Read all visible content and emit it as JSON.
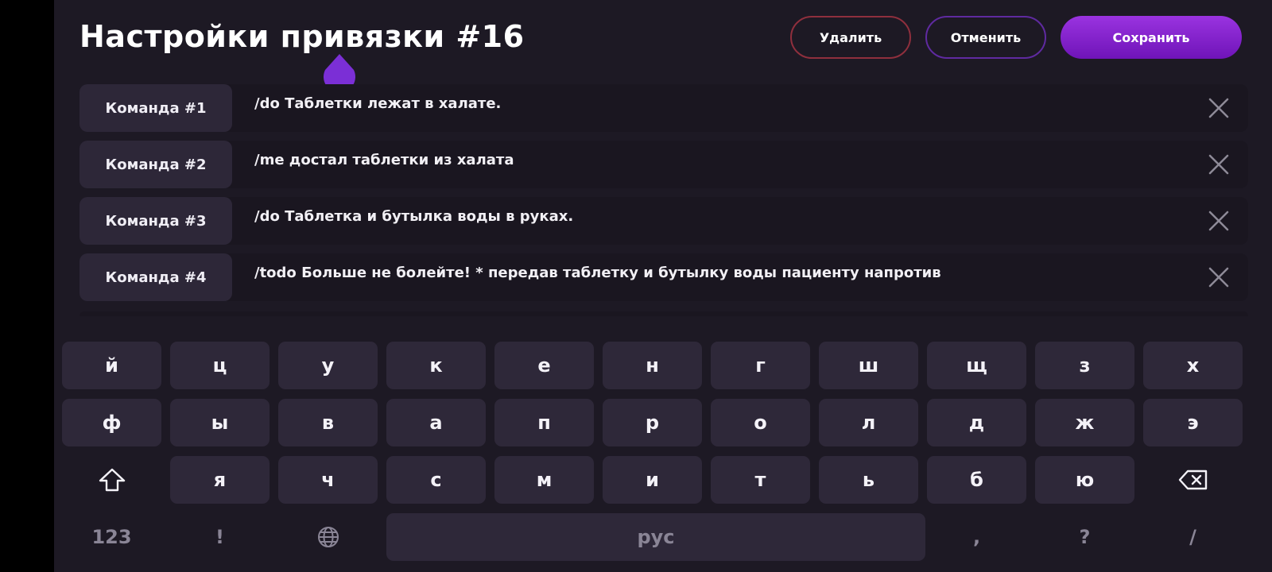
{
  "header": {
    "title": "Настройки привязки #16",
    "buttons": {
      "delete": "Удалить",
      "cancel": "Отменить",
      "save": "Сохранить"
    }
  },
  "commands": [
    {
      "label": "Команда #1",
      "text": "/do Таблетки лежат в халате."
    },
    {
      "label": "Команда #2",
      "text": "/me достал таблетки из халата"
    },
    {
      "label": "Команда #3",
      "text": "/do Таблетка и бутылка воды в руках."
    },
    {
      "label": "Команда #4",
      "text": "/todo Больше не болейте! * передав таблетку и бутылку воды пациенту напротив"
    }
  ],
  "keyboard": {
    "row1": [
      "й",
      "ц",
      "у",
      "к",
      "е",
      "н",
      "г",
      "ш",
      "щ",
      "з",
      "х"
    ],
    "row2": [
      "ф",
      "ы",
      "в",
      "а",
      "п",
      "р",
      "о",
      "л",
      "д",
      "ж",
      "э"
    ],
    "row3": [
      "я",
      "ч",
      "с",
      "м",
      "и",
      "т",
      "ь",
      "б",
      "ю"
    ],
    "bottom": {
      "numbers": "123",
      "exclamation": "!",
      "space": "рус",
      "comma": ",",
      "question": "?",
      "slash": "/"
    }
  },
  "colors": {
    "background": "#1d1924",
    "accent": "#8a2be2",
    "delete_border": "#8f2f3d",
    "cancel_border": "#5f2aa0",
    "key": "#2e2839"
  }
}
